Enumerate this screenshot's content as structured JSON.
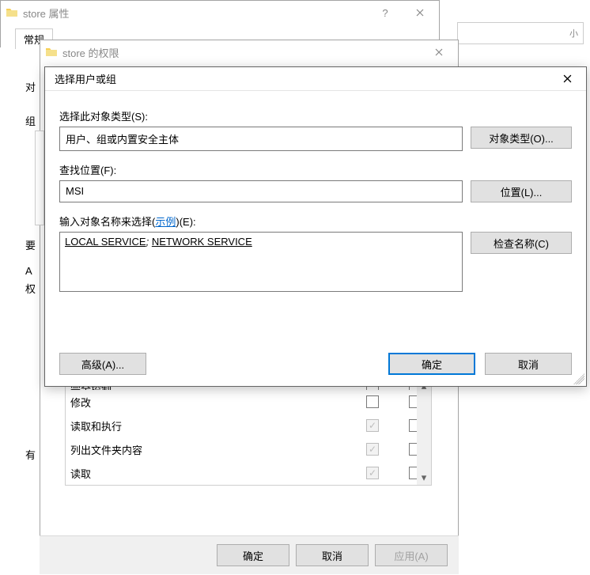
{
  "stray_fragment": "小",
  "win1": {
    "title": "store 属性",
    "tab_general": "常规"
  },
  "win2": {
    "title": "store 的权限",
    "obj_label": "对",
    "group_label": "组",
    "req_label": "要",
    "a_label": "A",
    "perm_label": "权",
    "etc_label": "有",
    "perm_rows": [
      {
        "name": "完全控制",
        "allow": false,
        "deny": false,
        "allow_disabled": false
      },
      {
        "name": "修改",
        "allow": false,
        "deny": false,
        "allow_disabled": false
      },
      {
        "name": "读取和执行",
        "allow": true,
        "deny": false,
        "allow_disabled": true
      },
      {
        "name": "列出文件夹内容",
        "allow": true,
        "deny": false,
        "allow_disabled": true
      },
      {
        "name": "读取",
        "allow": true,
        "deny": false,
        "allow_disabled": true
      }
    ],
    "btn_ok": "确定",
    "btn_cancel": "取消",
    "btn_apply": "应用(A)"
  },
  "win3": {
    "title": "选择用户或组",
    "label_object_type": "选择此对象类型(S):",
    "object_type_value": "用户、组或内置安全主体",
    "btn_object_type": "对象类型(O)...",
    "label_location": "查找位置(F):",
    "location_value": "MSI",
    "btn_location": "位置(L)...",
    "label_names_prefix": "输入对象名称来选择(",
    "label_names_link": "示例",
    "label_names_suffix": ")(E):",
    "names_value_1": "LOCAL SERVICE",
    "names_sep": "; ",
    "names_value_2": "NETWORK SERVICE",
    "btn_check_names": "检查名称(C)",
    "btn_advanced": "高级(A)...",
    "btn_ok": "确定",
    "btn_cancel": "取消"
  }
}
